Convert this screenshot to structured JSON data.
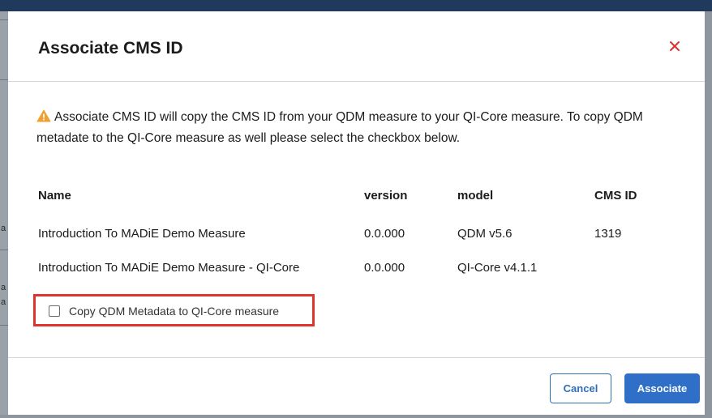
{
  "dialog": {
    "title": "Associate CMS ID",
    "close_icon": "close-icon",
    "warning_icon": "warning-triangle-icon",
    "warning_text": "Associate CMS ID will copy the CMS ID from your QDM measure to your QI-Core measure. To copy QDM metadate to the QI-Core measure as well please select the checkbox below."
  },
  "table": {
    "headers": {
      "name": "Name",
      "version": "version",
      "model": "model",
      "cms_id": "CMS ID"
    },
    "rows": [
      {
        "name": "Introduction To MADiE Demo Measure",
        "version": "0.0.000",
        "model": "QDM v5.6",
        "cms_id": "1319"
      },
      {
        "name": "Introduction To MADiE Demo Measure - QI-Core",
        "version": "0.0.000",
        "model": "QI-Core v4.1.1",
        "cms_id": ""
      }
    ]
  },
  "checkbox": {
    "label": "Copy QDM Metadata to QI-Core measure",
    "checked": false
  },
  "footer": {
    "cancel_label": "Cancel",
    "associate_label": "Associate"
  },
  "background": {
    "left_chars": [
      "a",
      "a",
      "a"
    ]
  },
  "colors": {
    "accent": "#2f6fc8",
    "close": "#d9342b",
    "warning": "#f0a030",
    "highlight_border": "#e0332d"
  }
}
